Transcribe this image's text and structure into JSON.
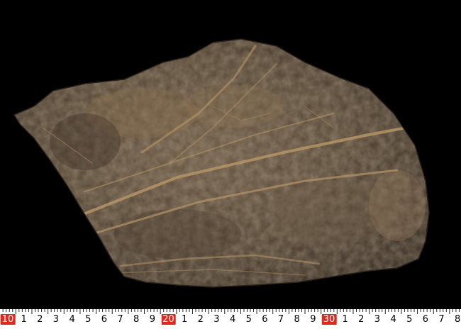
{
  "photo": {
    "subject": "fossil leaf impression on dark brown rock slab",
    "background_color": "#000000",
    "rock_color": "#5a4a3a",
    "highlight_color": "#9b7d55",
    "vein_color": "#b59466"
  },
  "ruler": {
    "tape_color": "#ffffff",
    "accent_color": "#e0281d",
    "labels": [
      "10",
      "1",
      "2",
      "3",
      "4",
      "5",
      "6",
      "7",
      "8",
      "9",
      "20",
      "1",
      "2",
      "3",
      "4",
      "5",
      "6",
      "7",
      "8",
      "9",
      "30",
      "1",
      "2",
      "3",
      "4",
      "5",
      "6",
      "7",
      "8"
    ],
    "highlighted": [
      "10",
      "20",
      "30"
    ]
  }
}
